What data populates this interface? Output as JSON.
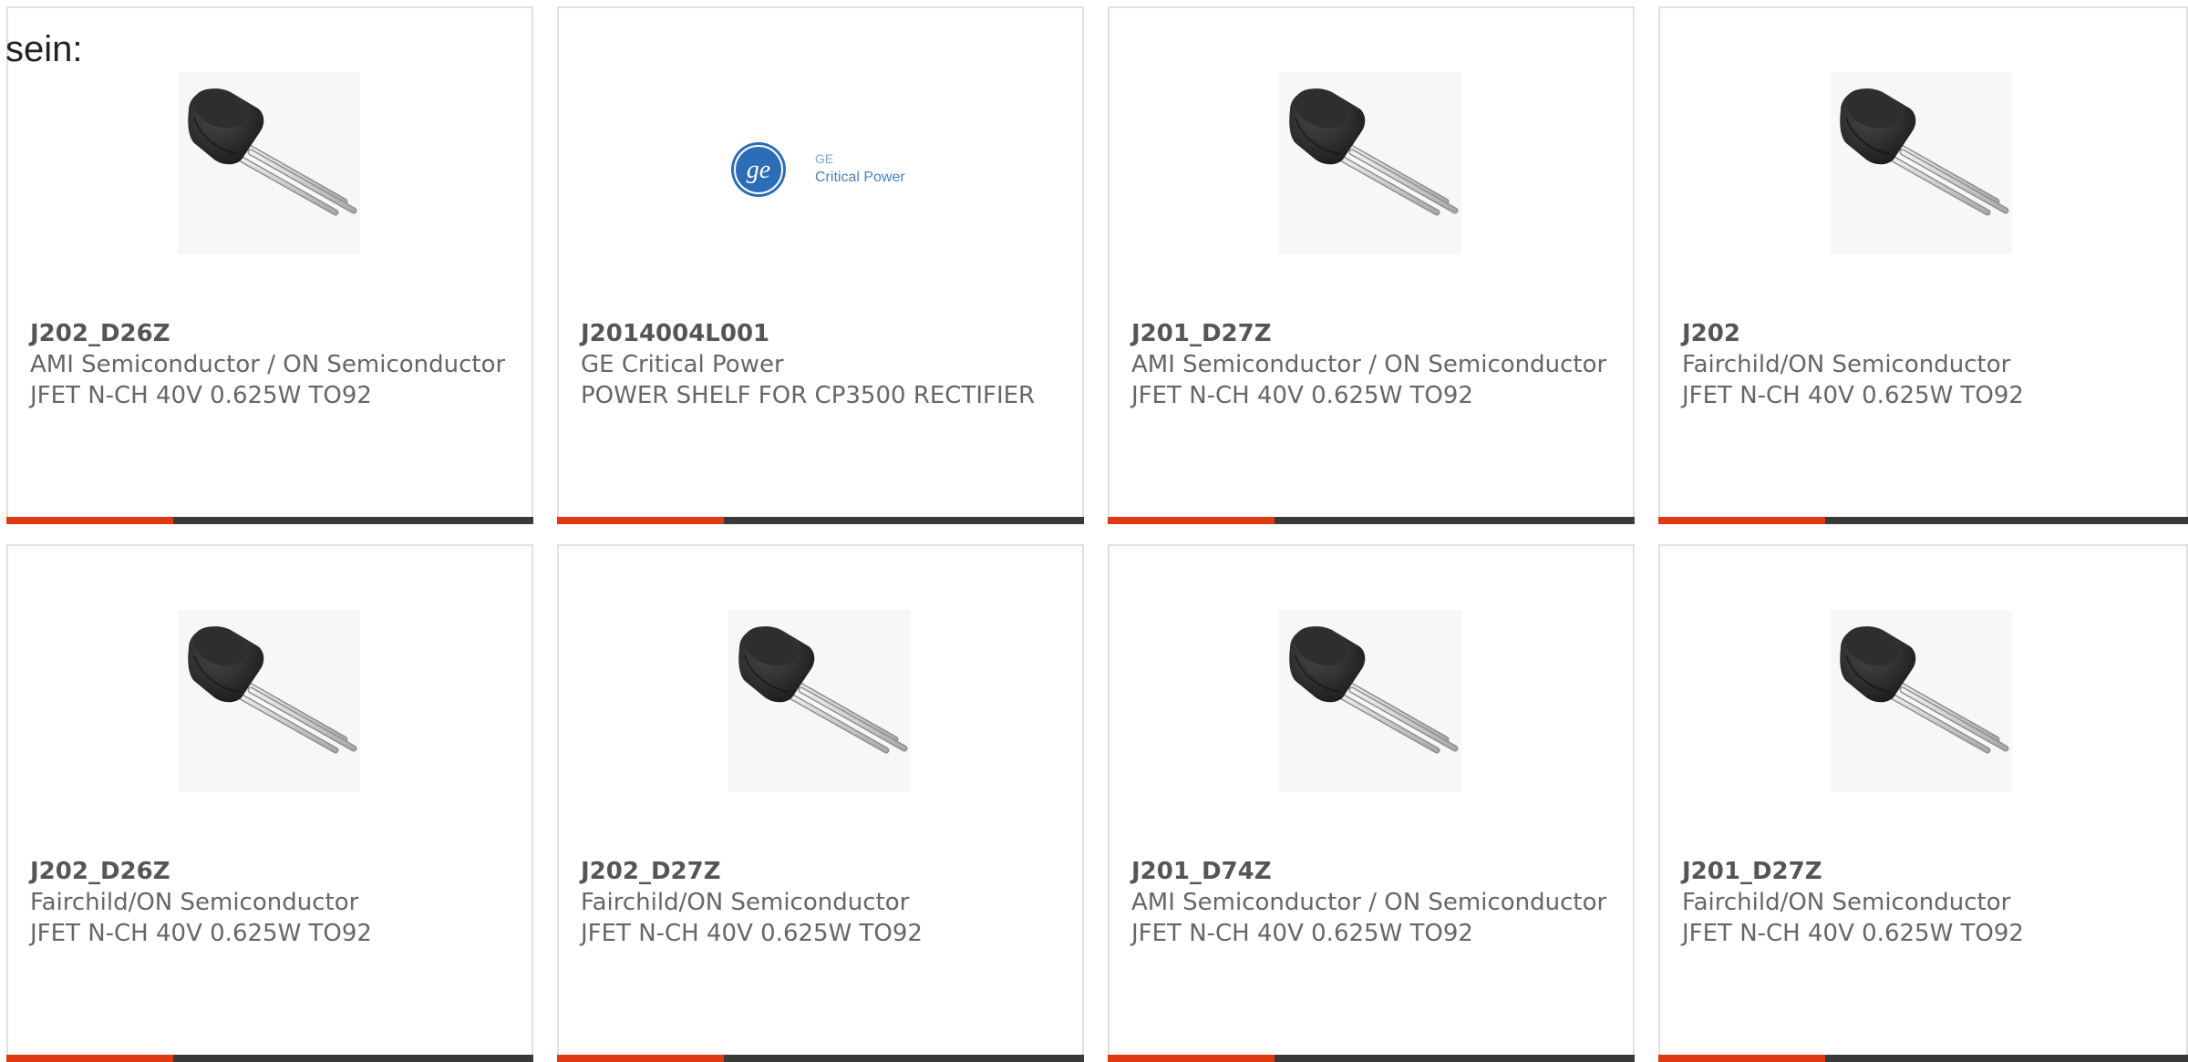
{
  "intro_text": "sein:",
  "colors": {
    "accent": "#e03a12",
    "bar": "#3a3a3a",
    "border": "#e1e1e1",
    "text": "#666666"
  },
  "products": [
    {
      "part_number": "J202_D26Z",
      "manufacturer": "AMI Semiconductor / ON Semiconductor",
      "description": "JFET N-CH 40V 0.625W TO92",
      "image": "to92-transistor-image"
    },
    {
      "part_number": "J2014004L001",
      "manufacturer": "GE Critical Power",
      "description": "POWER SHELF FOR CP3500 RECTIFIER",
      "image": "ge-critical-power-logo",
      "logo_line1": "GE",
      "logo_line2": "Critical Power"
    },
    {
      "part_number": "J201_D27Z",
      "manufacturer": "AMI Semiconductor / ON Semiconductor",
      "description": "JFET N-CH 40V 0.625W TO92",
      "image": "to92-transistor-image"
    },
    {
      "part_number": "J202",
      "manufacturer": "Fairchild/ON Semiconductor",
      "description": "JFET N-CH 40V 0.625W TO92",
      "image": "to92-transistor-image"
    },
    {
      "part_number": "J202_D26Z",
      "manufacturer": "Fairchild/ON Semiconductor",
      "description": "JFET N-CH 40V 0.625W TO92",
      "image": "to92-transistor-image"
    },
    {
      "part_number": "J202_D27Z",
      "manufacturer": "Fairchild/ON Semiconductor",
      "description": "JFET N-CH 40V 0.625W TO92",
      "image": "to92-transistor-image"
    },
    {
      "part_number": "J201_D74Z",
      "manufacturer": "AMI Semiconductor / ON Semiconductor",
      "description": "JFET N-CH 40V 0.625W TO92",
      "image": "to92-transistor-image"
    },
    {
      "part_number": "J201_D27Z",
      "manufacturer": "Fairchild/ON Semiconductor",
      "description": "JFET N-CH 40V 0.625W TO92",
      "image": "to92-transistor-image"
    }
  ]
}
